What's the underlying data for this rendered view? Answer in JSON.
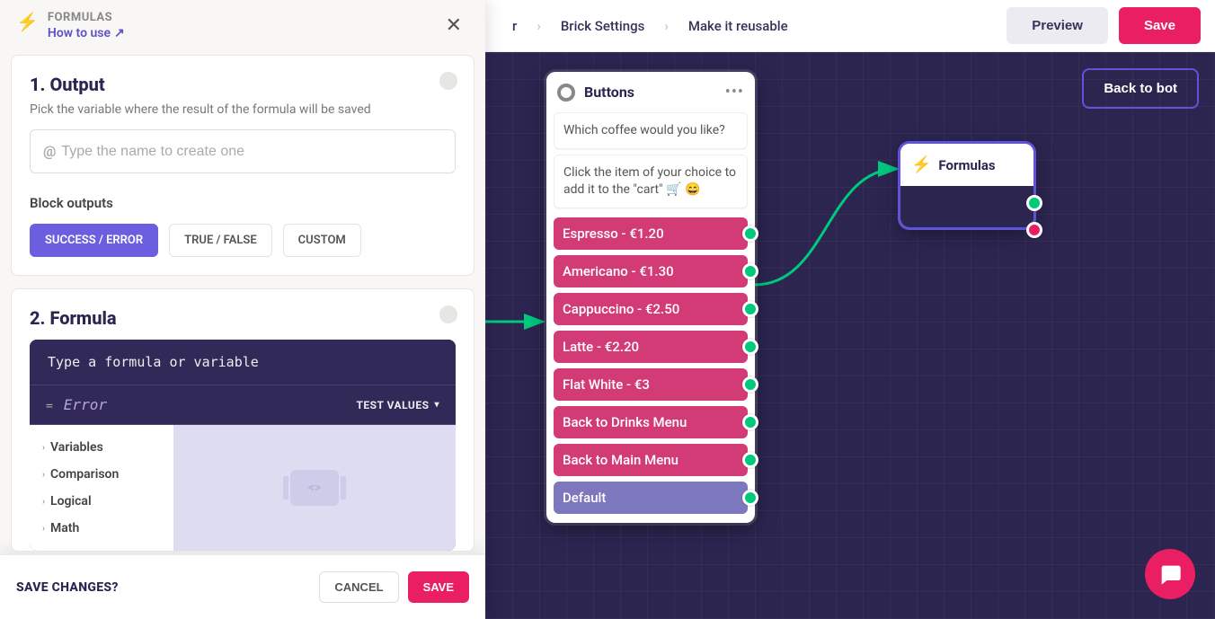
{
  "header": {
    "breadcrumbs": [
      "r",
      "Brick Settings",
      "Make it reusable"
    ],
    "preview_label": "Preview",
    "save_label": "Save"
  },
  "canvas": {
    "back_label": "Back to bot",
    "buttons_card": {
      "title": "Buttons",
      "messages": [
        "Which coffee would you like?",
        "Click the item of your choice to add it to the \"cart\" 🛒 😄"
      ],
      "options": [
        {
          "label": "Espresso - €1.20",
          "style": "pink"
        },
        {
          "label": "Americano - €1.30",
          "style": "pink"
        },
        {
          "label": "Cappuccino - €2.50",
          "style": "pink"
        },
        {
          "label": "Latte - €2.20",
          "style": "pink"
        },
        {
          "label": "Flat White - €3",
          "style": "pink"
        },
        {
          "label": "Back to Drinks Menu",
          "style": "pink"
        },
        {
          "label": "Back to Main Menu",
          "style": "pink"
        },
        {
          "label": "Default",
          "style": "purple"
        }
      ]
    },
    "formulas_node": {
      "title": "Formulas"
    }
  },
  "panel": {
    "title": "FORMULAS",
    "howto": "How to use",
    "section1": {
      "heading": "1. Output",
      "subtitle": "Pick the variable where the result of the formula will be saved",
      "placeholder": "Type the name to create one",
      "block_outputs_label": "Block outputs",
      "segments": [
        "SUCCESS / ERROR",
        "TRUE / FALSE",
        "CUSTOM"
      ],
      "active_segment": 0
    },
    "section2": {
      "heading": "2. Formula",
      "editor_placeholder": "Type a formula or variable",
      "error_label": "Error",
      "test_values_label": "TEST VALUES",
      "categories": [
        "Variables",
        "Comparison",
        "Logical",
        "Math"
      ]
    }
  },
  "savebar": {
    "question": "SAVE CHANGES?",
    "cancel": "CANCEL",
    "save": "SAVE"
  }
}
